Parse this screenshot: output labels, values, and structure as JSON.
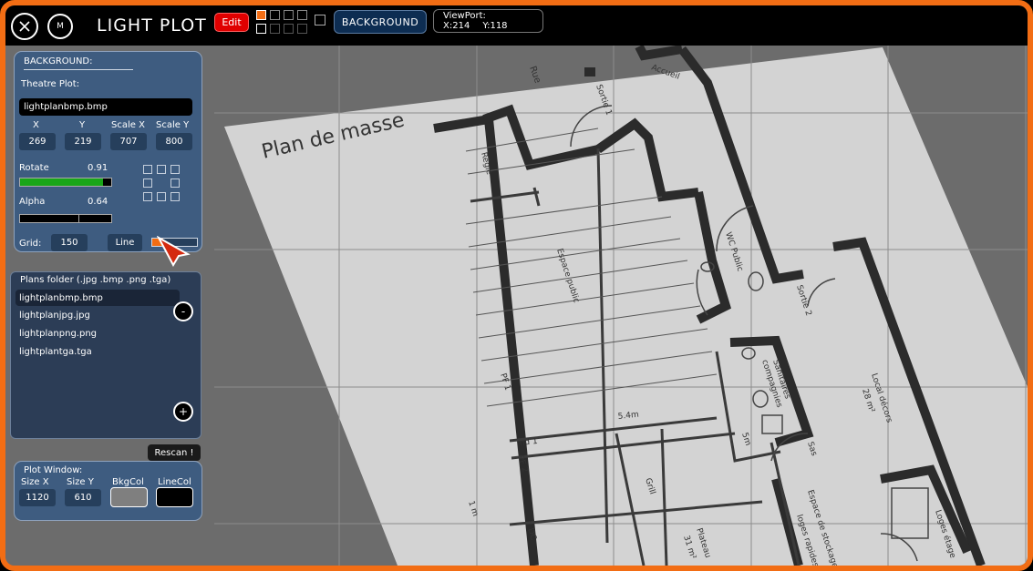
{
  "window": {
    "title": "LIGHT PLOT",
    "close_icon": "close-icon",
    "menu_label": "M",
    "edit_label": "Edit",
    "background_label": "BACKGROUND",
    "viewport": {
      "label": "ViewPort:",
      "x": "X:214",
      "y": "Y:118"
    },
    "colors": {
      "frame": "#f26d14",
      "selected_swatch": "#f26d14"
    }
  },
  "background_panel": {
    "title": "BACKGROUND:",
    "theatre_plot_label": "Theatre Plot:",
    "filename": "lightplanbmp.bmp",
    "headers": [
      "X",
      "Y",
      "Scale X",
      "Scale Y"
    ],
    "values": [
      "269",
      "219",
      "707",
      "800"
    ],
    "rotate": {
      "label": "Rotate",
      "value": "0.91",
      "fill": 0.91
    },
    "alpha": {
      "label": "Alpha",
      "value": "0.64",
      "fill": 0.64
    },
    "grid_label": "Grid:",
    "grid_value": "150",
    "line_label": "Line"
  },
  "plans": {
    "header": "Plans folder (.jpg .bmp .png .tga)",
    "files": [
      "lightplanbmp.bmp",
      "lightplanjpg.jpg",
      "lightplanpng.png",
      "lightplantga.tga"
    ],
    "remove_label": "-",
    "add_label": "+",
    "rescan_label": "Rescan !"
  },
  "plot_window": {
    "title": "Plot Window:",
    "size_x_label": "Size X",
    "size_y_label": "Size Y",
    "bkg_label": "BkgCol",
    "line_label": "LineCol",
    "size_x": "1120",
    "size_y": "610"
  },
  "plan": {
    "title": "Plan de masse",
    "labels": {
      "rue": "Rue",
      "sortie1": "Sortie 1",
      "accueil": "Accueil",
      "regie": "Régie",
      "espace_public": "Espace public",
      "wc_public": "WC Public",
      "sortie2": "Sortie 2",
      "sanitaires": "Sanitaires",
      "compagnies": "compagnies",
      "local_decors": "Local décors",
      "local_area": "28 m²",
      "pf1": "PF 1",
      "rnd1": "nd 1",
      "pf2": "PF 2",
      "dist": "5.4m",
      "five_m": "5m",
      "sas": "Sas",
      "grill": "Grill",
      "plateau": "Plateau",
      "plateau_area": "31 m²",
      "dc": "DC",
      "one_m": "1 m",
      "espace_stockage": "Espace de stockage",
      "loges_rapides": "loges rapides",
      "loges_etage": "Loges étage"
    }
  }
}
